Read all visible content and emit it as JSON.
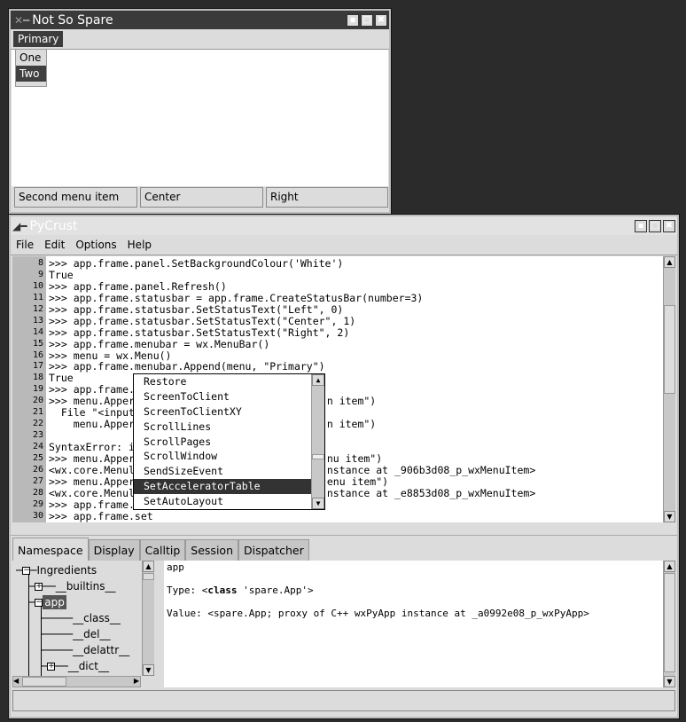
{
  "spare_window": {
    "title": "Not So Spare",
    "menu": {
      "label": "Primary",
      "items": [
        "One",
        "Two"
      ],
      "selected": "Two"
    },
    "status": [
      "Second menu item",
      "Center",
      "Right"
    ]
  },
  "crust_window": {
    "title": "PyCrust",
    "menus": [
      "File",
      "Edit",
      "Options",
      "Help"
    ],
    "lines": [
      {
        "n": "8",
        "text": ">>> app.frame.panel.SetBackgroundColour('White')",
        "tail": ""
      },
      {
        "n": "9",
        "text": "True",
        "tail": ""
      },
      {
        "n": "10",
        "text": ">>> app.frame.panel.Refresh()",
        "tail": ""
      },
      {
        "n": "11",
        "text": ">>> app.frame.statusbar = app.frame.CreateStatusBar(number=3)",
        "tail": ""
      },
      {
        "n": "12",
        "text": ">>> app.frame.statusbar.SetStatusText(\"Left\", 0)",
        "tail": ""
      },
      {
        "n": "13",
        "text": ">>> app.frame.statusbar.SetStatusText(\"Center\", 1)",
        "tail": ""
      },
      {
        "n": "14",
        "text": ">>> app.frame.statusbar.SetStatusText(\"Right\", 2)",
        "tail": ""
      },
      {
        "n": "15",
        "text": ">>> app.frame.menubar = wx.MenuBar()",
        "tail": ""
      },
      {
        "n": "16",
        "text": ">>> menu = wx.Menu()",
        "tail": ""
      },
      {
        "n": "17",
        "text": ">>> app.frame.menubar.Append(menu, \"Primary\")",
        "tail": ""
      },
      {
        "n": "18",
        "text": "True",
        "tail": ""
      },
      {
        "n": "19",
        "text": ">>> app.frame.",
        "tail": ""
      },
      {
        "n": "20",
        "text": ">>> menu.Apper",
        "tail": "  n item\")"
      },
      {
        "n": "21",
        "text": "  File \"<input",
        "tail": ""
      },
      {
        "n": "22",
        "text": "    menu.Apper",
        "tail": "  n item\")"
      },
      {
        "n": "23",
        "text": "",
        "tail": ""
      },
      {
        "n": "24",
        "text": "SyntaxError: i",
        "tail": ""
      },
      {
        "n": "25",
        "text": ">>> menu.Apper",
        "tail": "  nu item\")"
      },
      {
        "n": "26",
        "text": "<wx.core.Menul",
        "tail": "  nstance at _906b3d08_p_wxMenuItem>"
      },
      {
        "n": "27",
        "text": ">>> menu.Apper",
        "tail": "  enu item\")"
      },
      {
        "n": "28",
        "text": "<wx.core.Menul",
        "tail": "  nstance at _e8853d08_p_wxMenuItem>"
      },
      {
        "n": "29",
        "text": ">>> app.frame.",
        "tail": ""
      },
      {
        "n": "30",
        "text": ">>> app.frame.set",
        "tail": ""
      }
    ],
    "autocomplete": {
      "items": [
        "Restore",
        "ScreenToClient",
        "ScreenToClientXY",
        "ScrollLines",
        "ScrollPages",
        "ScrollWindow",
        "SendSizeEvent",
        "SetAcceleratorTable",
        "SetAutoLayout"
      ],
      "selected": "SetAcceleratorTable"
    },
    "tabs": [
      "Namespace",
      "Display",
      "Calltip",
      "Session",
      "Dispatcher"
    ],
    "active_tab": "Namespace",
    "tree": {
      "root": "Ingredients",
      "builtins": "__builtins__",
      "app": "app",
      "class": "__class__",
      "del": "__del__",
      "delattr": "__delattr__",
      "dict": "__dict__"
    },
    "detail": {
      "name": "app",
      "type_label": "Type: ",
      "type_open": "<",
      "type_kw": "class",
      "type_rest": " 'spare.App'>",
      "value": "Value: <spare.App; proxy of C++ wxPyApp instance at _a0992e08_p_wxPyApp>"
    }
  }
}
